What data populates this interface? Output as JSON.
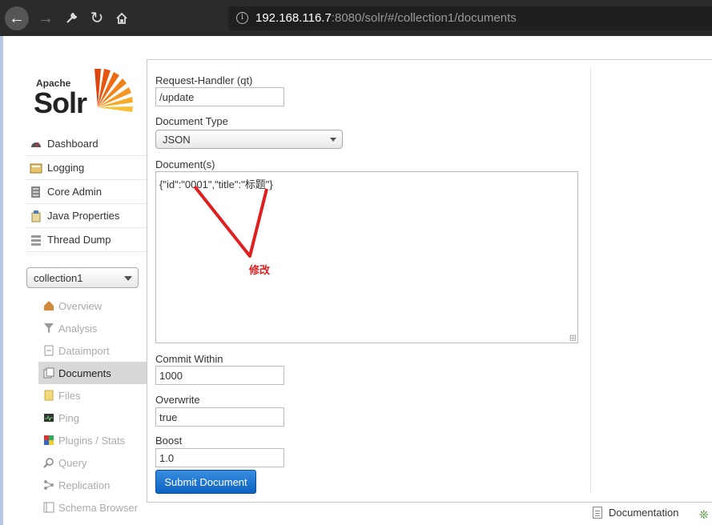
{
  "browser": {
    "url_host": "192.168.116.7",
    "url_rest": ":8080/solr/#/collection1/documents"
  },
  "logo": {
    "apache": "Apache",
    "solr": "Solr"
  },
  "sidebar": {
    "items": [
      {
        "label": "Dashboard",
        "icon": "dashboard-icon"
      },
      {
        "label": "Logging",
        "icon": "logging-icon"
      },
      {
        "label": "Core Admin",
        "icon": "core-admin-icon"
      },
      {
        "label": "Java Properties",
        "icon": "java-properties-icon"
      },
      {
        "label": "Thread Dump",
        "icon": "thread-dump-icon"
      }
    ],
    "core_selected": "collection1",
    "core_items": [
      {
        "label": "Overview",
        "icon": "overview-icon"
      },
      {
        "label": "Analysis",
        "icon": "analysis-icon"
      },
      {
        "label": "Dataimport",
        "icon": "dataimport-icon"
      },
      {
        "label": "Documents",
        "icon": "documents-icon",
        "active": true
      },
      {
        "label": "Files",
        "icon": "files-icon"
      },
      {
        "label": "Ping",
        "icon": "ping-icon"
      },
      {
        "label": "Plugins / Stats",
        "icon": "plugins-icon"
      },
      {
        "label": "Query",
        "icon": "query-icon"
      },
      {
        "label": "Replication",
        "icon": "replication-icon"
      },
      {
        "label": "Schema Browser",
        "icon": "schema-browser-icon"
      }
    ]
  },
  "form": {
    "handler_label": "Request-Handler (qt)",
    "handler_value": "/update",
    "doctype_label": "Document Type",
    "doctype_value": "JSON",
    "documents_label": "Document(s)",
    "documents_value": "{\"id\":\"0001\",\"title\":\"标题\"}",
    "commit_label": "Commit Within",
    "commit_value": "1000",
    "overwrite_label": "Overwrite",
    "overwrite_value": "true",
    "boost_label": "Boost",
    "boost_value": "1.0",
    "submit_label": "Submit Document"
  },
  "annotation": {
    "text": "修改",
    "color": "#e02020"
  },
  "footer": {
    "documentation": "Documentation"
  },
  "colors": {
    "accent": "#0a62c2",
    "annotation": "#e02020",
    "active_bg": "#d8d8d8"
  }
}
